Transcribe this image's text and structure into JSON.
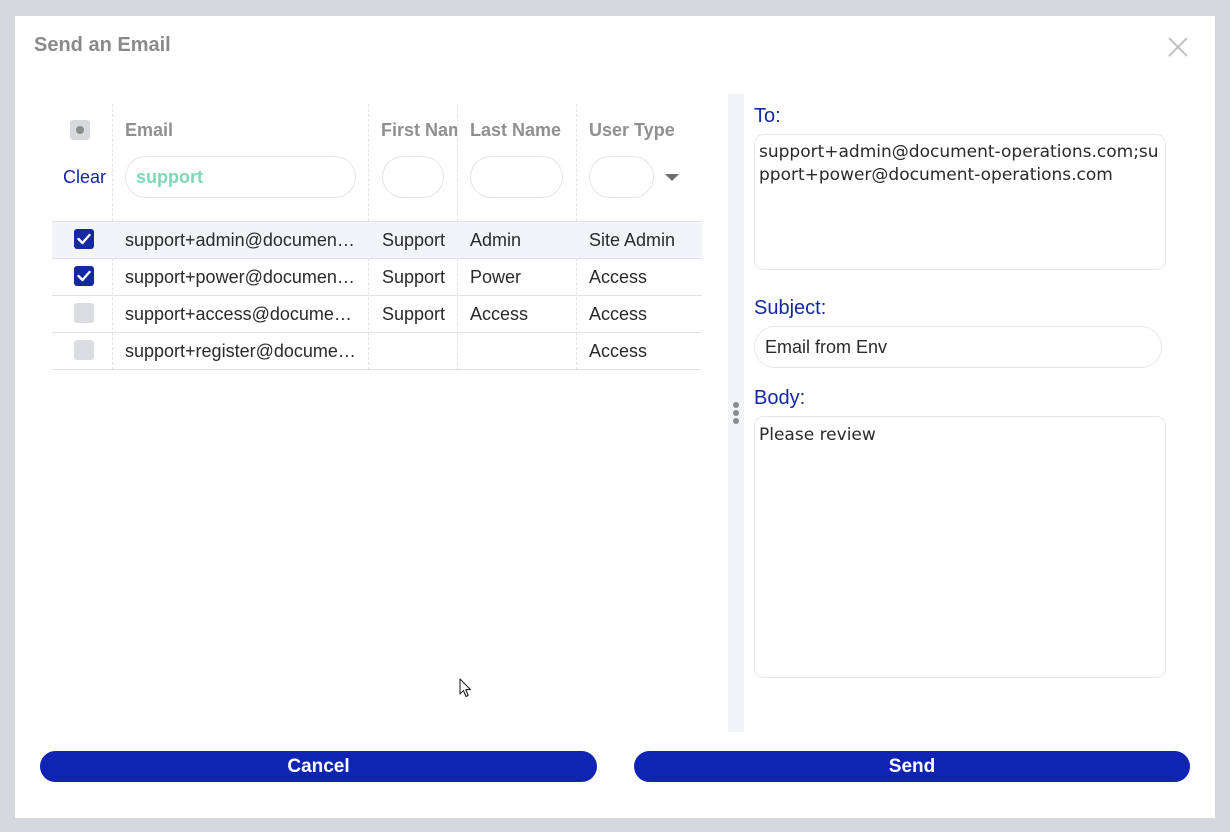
{
  "dialog": {
    "title": "Send an Email",
    "close_icon": "close-icon"
  },
  "grid": {
    "clear_label": "Clear",
    "columns": [
      {
        "label": "Email"
      },
      {
        "label": "First Name"
      },
      {
        "label": "Last Name"
      },
      {
        "label": "User Type"
      }
    ],
    "filters": {
      "email": "support",
      "first_name": "",
      "last_name": "",
      "user_type": ""
    },
    "rows": [
      {
        "checked": true,
        "email": "support+admin@document-operations.com",
        "first_name": "Support",
        "last_name": "Admin",
        "user_type": "Site Admin"
      },
      {
        "checked": true,
        "email": "support+power@document-operations.com",
        "first_name": "Support",
        "last_name": "Power",
        "user_type": "Access"
      },
      {
        "checked": false,
        "email": "support+access@document-operations.com",
        "first_name": "Support",
        "last_name": "Access",
        "user_type": "Access"
      },
      {
        "checked": false,
        "email": "support+register@document-operations.com",
        "first_name": "",
        "last_name": "",
        "user_type": "Access"
      }
    ]
  },
  "form": {
    "to_label": "To:",
    "to_value": "support+admin@document-operations.com;support+power@document-operations.com",
    "subject_label": "Subject:",
    "subject_value": "Email from Env",
    "body_label": "Body:",
    "body_value": "Please review"
  },
  "buttons": {
    "cancel": "Cancel",
    "send": "Send"
  },
  "colors": {
    "accent": "#1428a0",
    "button": "#1024b4",
    "filter_text": "#7ed9b3"
  }
}
